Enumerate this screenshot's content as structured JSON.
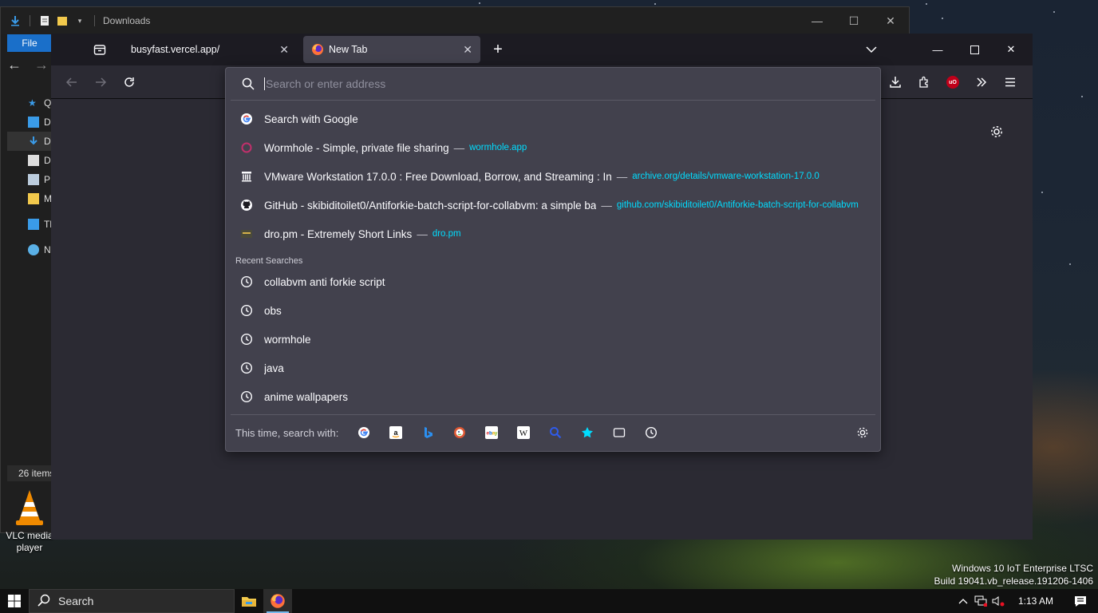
{
  "explorer": {
    "title": "Downloads",
    "file_tab": "File",
    "sidebar": [
      {
        "label": "Qu",
        "icon": "star-icon"
      },
      {
        "label": "D",
        "icon": "desktop-icon"
      },
      {
        "label": "D",
        "icon": "download-icon"
      },
      {
        "label": "D",
        "icon": "document-icon"
      },
      {
        "label": "P",
        "icon": "picture-icon"
      },
      {
        "label": "M",
        "icon": "folder-icon"
      },
      {
        "label": "Th",
        "icon": "pc-icon"
      },
      {
        "label": "Ne",
        "icon": "network-icon"
      }
    ],
    "status": "26 items"
  },
  "desktop": {
    "vlc_label": "VLC media player"
  },
  "firefox": {
    "tabs": [
      {
        "label": "busyfast.vercel.app/",
        "active": false
      },
      {
        "label": "New Tab",
        "active": true
      }
    ],
    "address_placeholder": "Search or enter address",
    "suggestions": [
      {
        "title": "Search with Google",
        "url": "",
        "icon": "google-icon"
      },
      {
        "title": "Wormhole - Simple, private file sharing",
        "url": "wormhole.app",
        "icon": "wormhole-icon"
      },
      {
        "title": "VMware Workstation 17.0.0 : Free Download, Borrow, and Streaming : In",
        "url": "archive.org/details/vmware-workstation-17.0.0",
        "icon": "archive-icon"
      },
      {
        "title": "GitHub - skibiditoilet0/Antiforkie-batch-script-for-collabvm: a simple ba",
        "url": "github.com/skibiditoilet0/Antiforkie-batch-script-for-collabvm",
        "icon": "github-icon"
      },
      {
        "title": "dro.pm - Extremely Short Links",
        "url": "dro.pm",
        "icon": "dropm-icon"
      }
    ],
    "recent_heading": "Recent Searches",
    "recent": [
      "collabvm anti forkie script",
      "obs",
      "wormhole",
      "java",
      "anime wallpapers"
    ],
    "footer_label": "This time, search with:",
    "engines": [
      "google",
      "amazon",
      "bing",
      "duckduckgo",
      "ebay",
      "wikipedia",
      "search",
      "bookmarks",
      "tabs",
      "history"
    ],
    "addon_badge": "uO"
  },
  "watermark": {
    "line1": "Windows 10 IoT Enterprise LTSC",
    "line2": "Build 19041.vb_release.191206-1406"
  },
  "taskbar": {
    "search_label": "Search",
    "time": "1:13 AM"
  },
  "colors": {
    "accent": "#00ddff",
    "panel": "#42414d",
    "toolbar": "#2b2a33",
    "tabstrip": "#1c1b22",
    "explorer_file": "#1a6fc9"
  }
}
